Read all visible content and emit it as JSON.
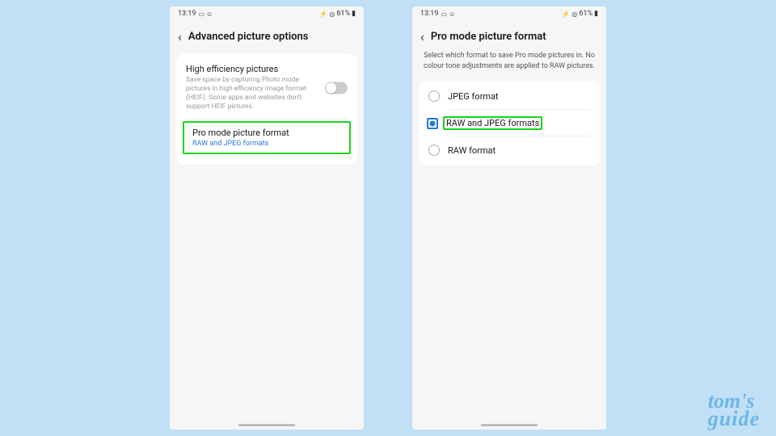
{
  "status": {
    "time": "13:19",
    "icons_left": "▭ ☺",
    "icons_right": "⚡ ◎",
    "battery": "61%",
    "battery_icon": "▮"
  },
  "screen1": {
    "title": "Advanced picture options",
    "heif": {
      "title": "High efficiency pictures",
      "desc": "Save space by capturing Photo mode pictures in high efficiency image format (HEIF). Some apps and websites don't support HEIF pictures."
    },
    "promode": {
      "title": "Pro mode picture format",
      "sub": "RAW and JPEG formats"
    }
  },
  "screen2": {
    "title": "Pro mode picture format",
    "desc": "Select which format to save Pro mode pictures in. No colour tone adjustments are applied to RAW pictures.",
    "options": {
      "opt1": "JPEG format",
      "opt2": "RAW and JPEG formats",
      "opt3": "RAW format"
    }
  },
  "watermark": {
    "line1": "tom's",
    "line2": "guide"
  }
}
